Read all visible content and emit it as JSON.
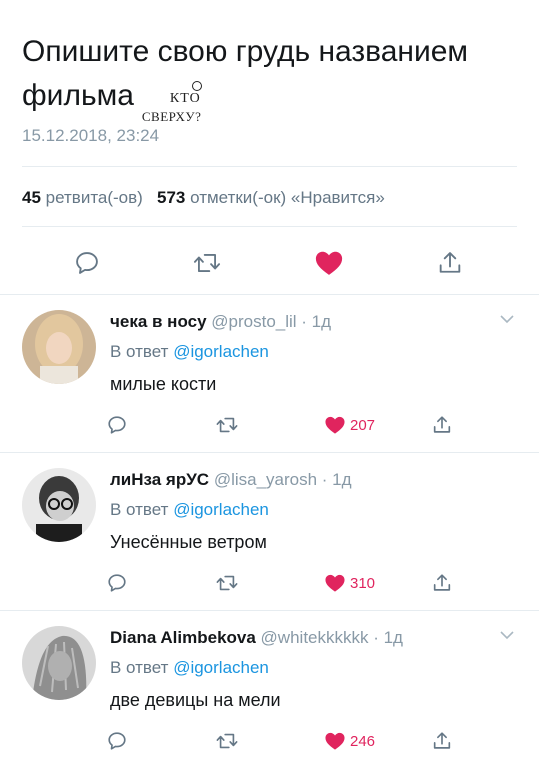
{
  "tweet": {
    "text_line1": "Опишите свою грудь названием",
    "text_line2": "фильма",
    "sticker_line1": "КТО",
    "sticker_line2": "СВЕРХУ?",
    "timestamp": "15.12.2018, 23:24",
    "retweet_count": "45",
    "retweet_label": "ретвита(-ов)",
    "like_count": "573",
    "like_label": "отметки(-ок) «Нравится»"
  },
  "colors": {
    "like": "#e0245e",
    "link": "#1b95e0",
    "muted": "#8899a6",
    "text": "#14171a"
  },
  "replies": [
    {
      "name": "чека в носу",
      "handle": "@prosto_lil · 1д",
      "reply_prefix": "В ответ",
      "reply_to": "@igorlachen",
      "text": "милые кости",
      "likes": "207"
    },
    {
      "name": "лиНза ярУС",
      "handle": "@lisa_yarosh · 1д",
      "reply_prefix": "В ответ",
      "reply_to": "@igorlachen",
      "text": "Унесённые ветром",
      "likes": "310"
    },
    {
      "name": "Diana Alimbekova",
      "handle": "@whitekkkkkk · 1д",
      "reply_prefix": "В ответ",
      "reply_to": "@igorlachen",
      "text": "две девицы на мели",
      "likes": "246"
    }
  ]
}
